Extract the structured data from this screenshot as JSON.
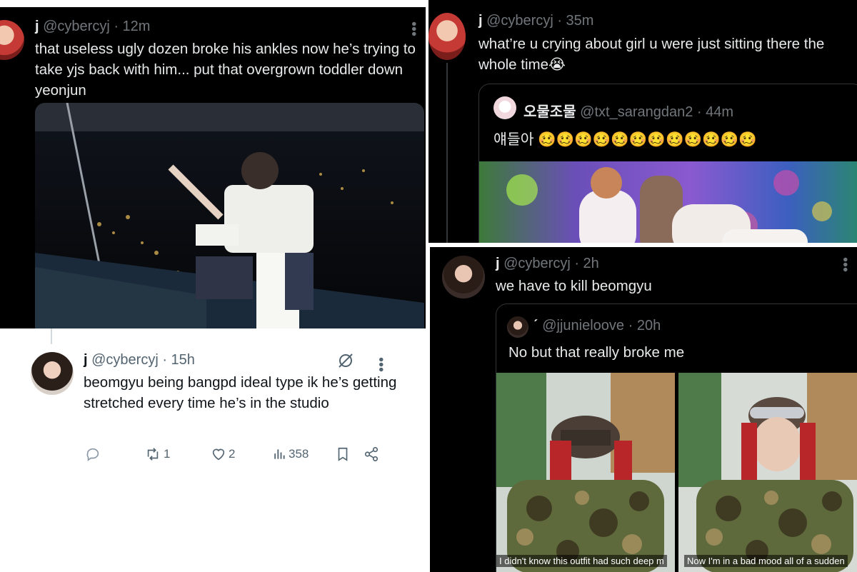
{
  "tweets": {
    "t1": {
      "name": "j",
      "handle": "@cybercyj",
      "time": "· 12m",
      "text": "that useless ugly dozen broke his ankles now he’s trying to take yjs back with him... put that overgrown toddler down yeonjun"
    },
    "t2": {
      "name": "j",
      "handle": "@cybercyj",
      "time": "· 15h",
      "text": "beomgyu being bangpd ideal type ik he’s getting stretched every time he’s in the studio",
      "actions": {
        "replies": "",
        "retweets": "1",
        "likes": "2",
        "views": "358"
      }
    },
    "t3": {
      "name": "j",
      "handle": "@cybercyj",
      "time": "· 35m",
      "text": "what’re u crying about girl u were just sitting there the whole time😭",
      "quote": {
        "name": "오물조물",
        "handle": "@txt_sarangdan2",
        "time": "· 44m",
        "text": "얘들아 🥴🥴🥴🥴🥴🥴🥴🥴🥴🥴🥴🥴"
      }
    },
    "t4": {
      "name": "j",
      "handle": "@cybercyj",
      "time": "· 2h",
      "text": "we have to kill beomgyu",
      "quote": {
        "name": "ˊ",
        "handle": "@jjunieloove",
        "time": "· 20h",
        "text": "No but that really broke me",
        "caption_left": "I didn't know this outfit had such deep m",
        "caption_right": "Now I'm in a bad mood all of a sudden"
      }
    }
  },
  "icons": {
    "more": "more-vertical-icon",
    "reply": "reply-icon",
    "retweet": "retweet-icon",
    "like": "heart-icon",
    "views": "views-icon",
    "bookmark": "bookmark-icon",
    "share": "share-icon",
    "grok": "grok-icon"
  },
  "colors": {
    "dark_bg": "#000000",
    "light_bg": "#ffffff",
    "muted": "#71767b",
    "text_dark": "#e7e9ea",
    "text_light": "#0f1419"
  }
}
